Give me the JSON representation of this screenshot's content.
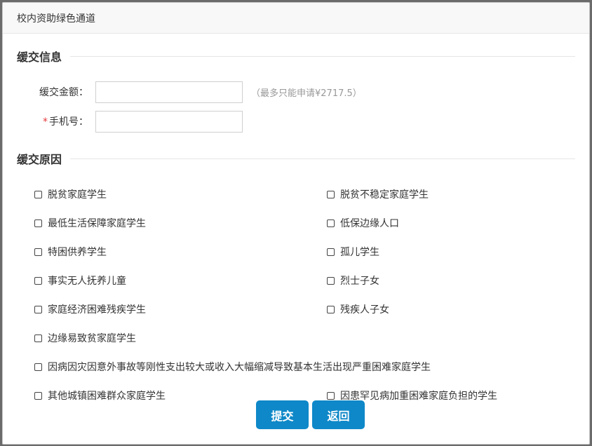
{
  "dialog": {
    "title": "校内资助绿色通道"
  },
  "info_section": {
    "heading": "缓交信息",
    "amount": {
      "label": "缓交金额：",
      "value": "",
      "hint": "（最多只能申请¥2717.5）"
    },
    "phone": {
      "required_mark": "*",
      "label": "手机号：",
      "value": ""
    }
  },
  "reason_section": {
    "heading": "缓交原因",
    "reasons": [
      {
        "label": "脱贫家庭学生",
        "checked": false
      },
      {
        "label": "脱贫不稳定家庭学生",
        "checked": false
      },
      {
        "label": "最低生活保障家庭学生",
        "checked": false
      },
      {
        "label": "低保边缘人口",
        "checked": false
      },
      {
        "label": "特困供养学生",
        "checked": false
      },
      {
        "label": "孤儿学生",
        "checked": false
      },
      {
        "label": "事实无人抚养儿童",
        "checked": false
      },
      {
        "label": "烈士子女",
        "checked": false
      },
      {
        "label": "家庭经济困难残疾学生",
        "checked": false
      },
      {
        "label": "残疾人子女",
        "checked": false
      },
      {
        "label": "边缘易致贫家庭学生",
        "checked": false
      },
      {
        "label": "因病因灾因意外事故等刚性支出较大或收入大幅缩减导致基本生活出现严重困难家庭学生",
        "checked": false
      },
      {
        "label": "其他城镇困难群众家庭学生",
        "checked": false
      },
      {
        "label": "因患罕见病加重困难家庭负担的学生",
        "checked": false
      }
    ]
  },
  "actions": {
    "submit_label": "提交",
    "back_label": "返回"
  },
  "colors": {
    "primary_button": "#0e88c8",
    "required": "#e4393c"
  }
}
